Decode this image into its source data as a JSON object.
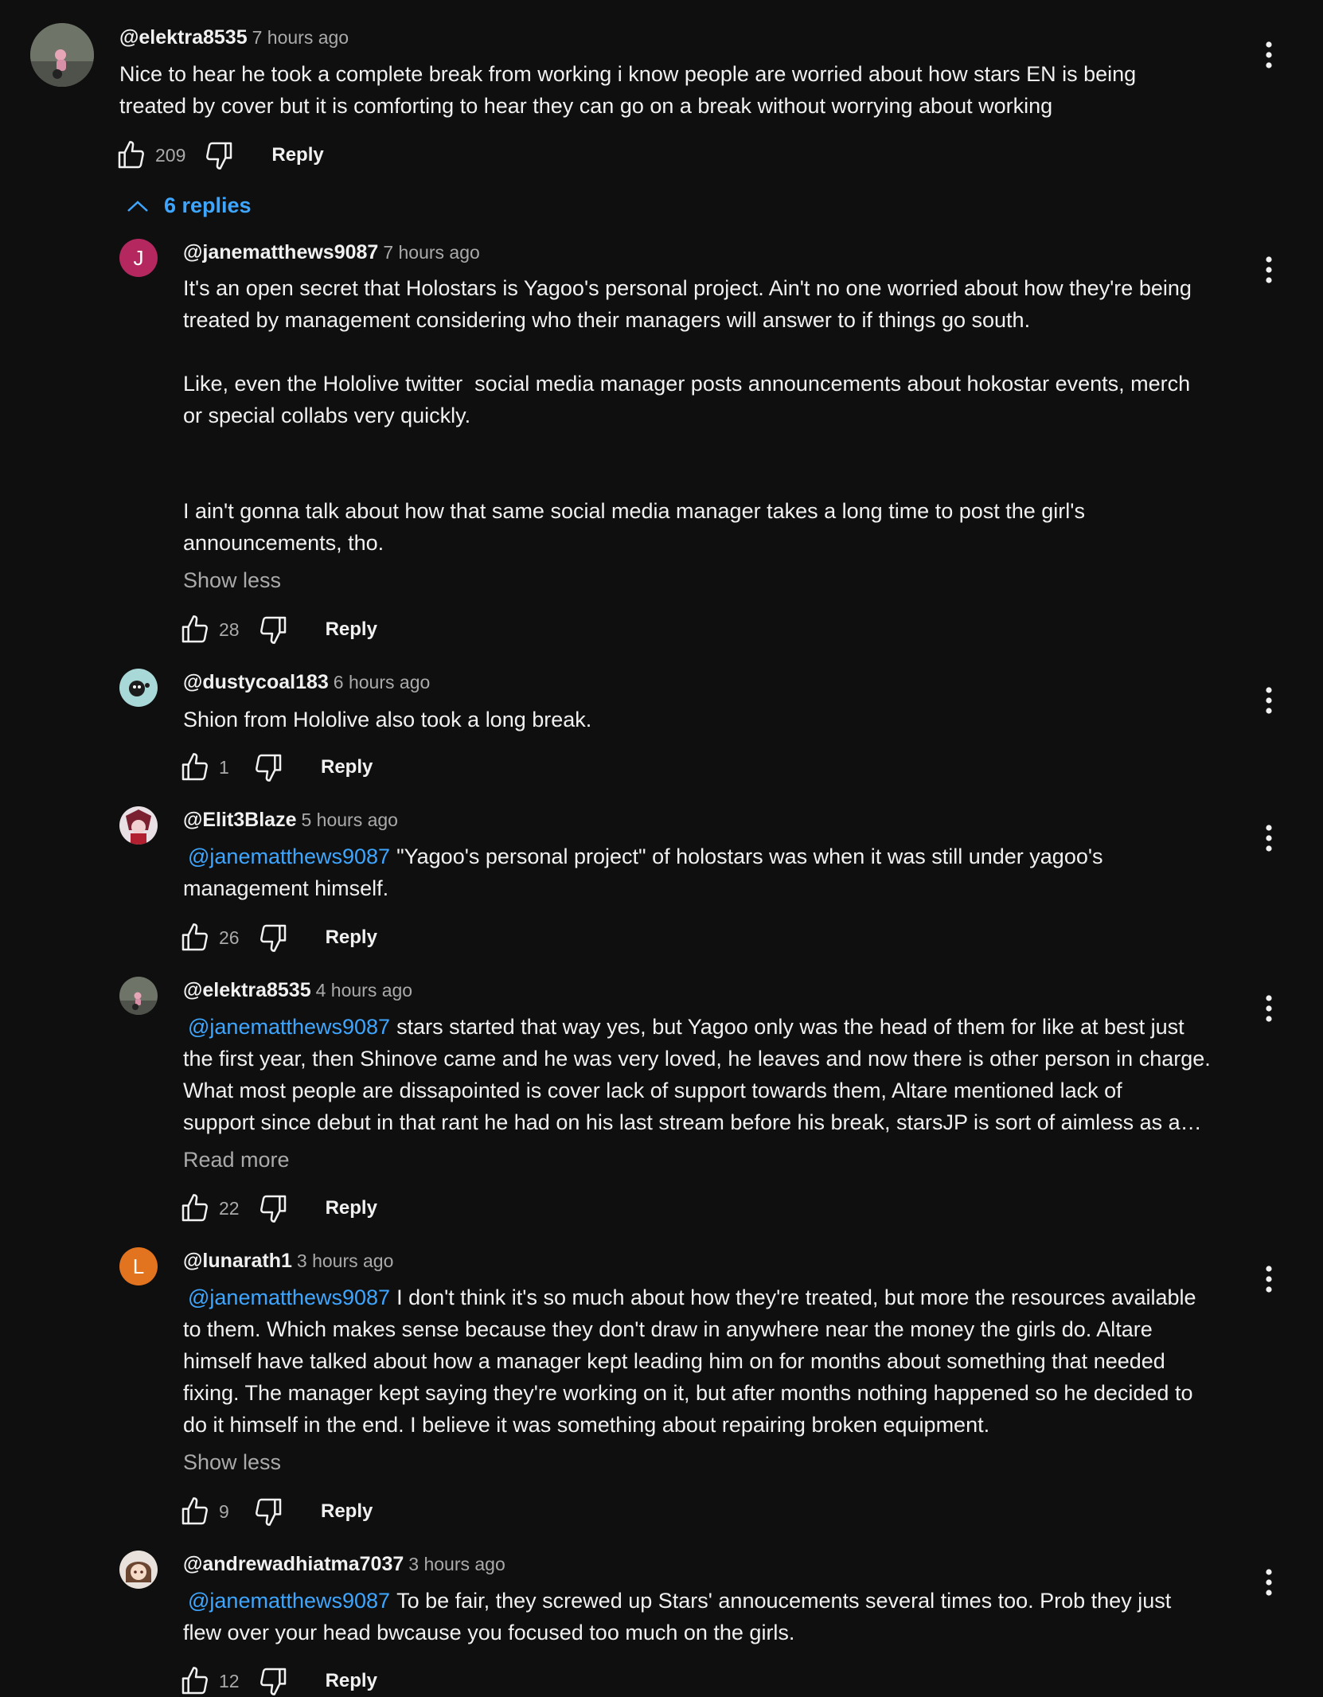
{
  "top_comment": {
    "author": "@elektra8535",
    "time": "7 hours ago",
    "text": "Nice to hear he took a complete break from working i know people are worried about how stars EN is being\ntreated by cover but it is comforting to hear they can go on a break without worrying about working",
    "likes": "209",
    "reply_label": "Reply",
    "replies_toggle": "6 replies"
  },
  "replies": [
    {
      "author": "@janematthews9087",
      "time": "7 hours ago",
      "avatar_letter": "J",
      "avatar_color": "#b5285f",
      "mention": "",
      "text": "It's an open secret that Holostars is Yagoo's personal project. Ain't no one worried about how they're being\ntreated by management considering who their managers will answer to if things go south.\n\nLike, even the Hololive twitter  social media manager posts announcements about hokostar events, merch\nor special collabs very quickly.\n\n\nI ain't gonna talk about how that same social media manager takes a long time to post the girl's\nannouncements, tho.",
      "toggle": "Show less",
      "likes": "28",
      "reply_label": "Reply"
    },
    {
      "author": "@dustycoal183",
      "time": "6 hours ago",
      "avatar_letter": "",
      "avatar_color": "#a9d8d8",
      "mention": "",
      "text": "Shion from Hololive also took a long break.",
      "toggle": "",
      "likes": "1",
      "reply_label": "Reply"
    },
    {
      "author": "@Elit3Blaze",
      "time": "5 hours ago",
      "avatar_letter": "",
      "avatar_color": "#7a2030",
      "mention": "@janematthews9087",
      "text": "\"Yagoo's personal project\" of holostars was when it was still under yagoo's\nmanagement himself.",
      "toggle": "",
      "likes": "26",
      "reply_label": "Reply"
    },
    {
      "author": "@elektra8535",
      "time": "4 hours ago",
      "avatar_letter": "",
      "avatar_color": "#6b6f66",
      "mention": "@janematthews9087",
      "text": "stars started that way yes, but Yagoo only was the head of them for like at best just\nthe first year, then Shinove came and he was very loved, he leaves and now there is other person in charge.\nWhat most people are dissapointed is cover lack of support towards them, Altare mentioned lack of\nsupport since debut in that rant he had on his last stream before his break, starsJP is sort of aimless as a…",
      "toggle": "Read more",
      "likes": "22",
      "reply_label": "Reply"
    },
    {
      "author": "@lunarath1",
      "time": "3 hours ago",
      "avatar_letter": "L",
      "avatar_color": "#e2731f",
      "mention": "@janematthews9087",
      "text": "I don't think it's so much about how they're treated, but more the resources available\nto them. Which makes sense because they don't draw in anywhere near the money the girls do. Altare\nhimself have talked about how a manager kept leading him on for months about something that needed\nfixing. The manager kept saying they're working on it, but after months nothing happened so he decided to\ndo it himself in the end. I believe it was something about repairing broken equipment.",
      "toggle": "Show less",
      "likes": "9",
      "reply_label": "Reply"
    },
    {
      "author": "@andrewadhiatma7037",
      "time": "3 hours ago",
      "avatar_letter": "",
      "avatar_color": "#d9b89a",
      "mention": "@janematthews9087",
      "text": "To be fair, they screwed up Stars' annoucements several times too. Prob they just\nflew over your head bwcause you focused too much on the girls.",
      "toggle": "",
      "likes": "12",
      "reply_label": "Reply"
    }
  ]
}
